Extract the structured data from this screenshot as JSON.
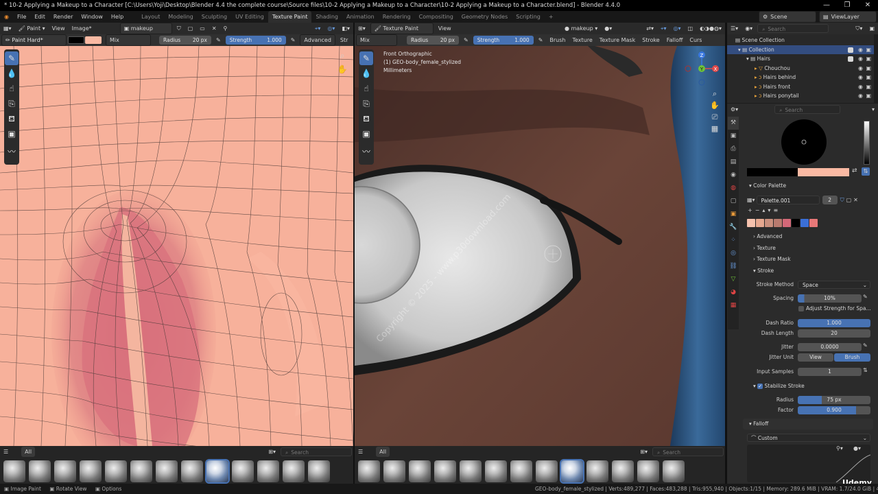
{
  "window": {
    "title": "* 10-2 Applying a Makeup to a Character [C:\\Users\\Yoji\\Desktop\\Blender 4.4 the complete course\\Source files\\10-2 Applying a Makeup to a Character\\10-2 Applying a Makeup to a Character.blend] - Blender 4.4.0",
    "min": "—",
    "max": "❐",
    "close": "✕"
  },
  "menus": [
    "File",
    "Edit",
    "Render",
    "Window",
    "Help"
  ],
  "workspaces": [
    "Layout",
    "Modeling",
    "Sculpting",
    "UV Editing",
    "Texture Paint",
    "Shading",
    "Animation",
    "Rendering",
    "Compositing",
    "Geometry Nodes",
    "Scripting",
    "+"
  ],
  "scene": {
    "name": "Scene",
    "view_layer": "ViewLayer"
  },
  "image_editor": {
    "mode": "Paint",
    "view": "View",
    "image_menu": "Image*",
    "image_name": "makeup",
    "brush": "Paint Hard*",
    "blend": "Mix",
    "radius_label": "Radius",
    "radius_value": "20 px",
    "strength_label": "Strength",
    "strength_value": "1.000",
    "advanced": "Advanced",
    "stroke": "Str",
    "all": "All",
    "search": "Search"
  },
  "viewport": {
    "mode": "Texture Paint",
    "view": "View",
    "material": "makeup",
    "blend": "Mix",
    "radius_label": "Radius",
    "radius_value": "20 px",
    "strength_label": "Strength",
    "strength_value": "1.000",
    "menus": [
      "Brush",
      "Texture",
      "Texture Mask",
      "Stroke",
      "Falloff",
      "Curs"
    ],
    "overlay_line1": "Front Orthographic",
    "overlay_line2": "(1) GEO-body_female_stylized",
    "overlay_line3": "Millimeters",
    "watermark": "Copyright © 2025 - www.p30download.com",
    "gizmo": {
      "z": "Z",
      "y": "Y",
      "x": "X"
    },
    "all": "All",
    "search": "Search"
  },
  "outliner": {
    "search": "Search",
    "items": [
      {
        "label": "Scene Collection",
        "indent": 0
      },
      {
        "label": "Collection",
        "indent": 1
      },
      {
        "label": "Hairs",
        "indent": 2
      },
      {
        "label": "Chouchou",
        "indent": 3
      },
      {
        "label": "Hairs behind",
        "indent": 3
      },
      {
        "label": "Hairs front",
        "indent": 3
      },
      {
        "label": "Hairs ponytail",
        "indent": 3
      }
    ]
  },
  "properties": {
    "search": "Search",
    "color_palette": {
      "header": "Color Palette",
      "name": "Palette.001",
      "users": "2"
    },
    "palette_colors": [
      "#f5c2ae",
      "#e6a890",
      "#c98f7d",
      "#b87a6e",
      "#d46878",
      "#000000",
      "#3b6fd6",
      "#e87878"
    ],
    "primary_color": "#000000",
    "secondary_color": "#f9b9a3",
    "sections": {
      "advanced": "Advanced",
      "texture": "Texture",
      "texture_mask": "Texture Mask",
      "stroke": "Stroke",
      "stabilize": "Stabilize Stroke",
      "falloff": "Falloff"
    },
    "stroke_method_label": "Stroke Method",
    "stroke_method": "Space",
    "spacing_label": "Spacing",
    "spacing": "10%",
    "adjust_strength": "Adjust Strength for Spa...",
    "dash_ratio_label": "Dash Ratio",
    "dash_ratio": "1.000",
    "dash_length_label": "Dash Length",
    "dash_length": "20",
    "jitter_label": "Jitter",
    "jitter": "0.0000",
    "jitter_unit_label": "Jitter Unit",
    "jitter_unit_view": "View",
    "jitter_unit_brush": "Brush",
    "input_samples_label": "Input Samples",
    "input_samples": "1",
    "stab_radius_label": "Radius",
    "stab_radius": "75 px",
    "stab_factor_label": "Factor",
    "stab_factor": "0.900",
    "falloff_preset": "Custom"
  },
  "status": {
    "left1": "Image Paint",
    "left2": "Rotate View",
    "left3": "Options",
    "right": "GEO-body_female_stylized | Verts:489,277 | Faces:483,288 | Tris:955,940 | Objects:1/15 | Memory: 289.6 MiB | VRAM: 1.7/24.0 GiB | 4.4.0",
    "udemy": "Udemy"
  }
}
